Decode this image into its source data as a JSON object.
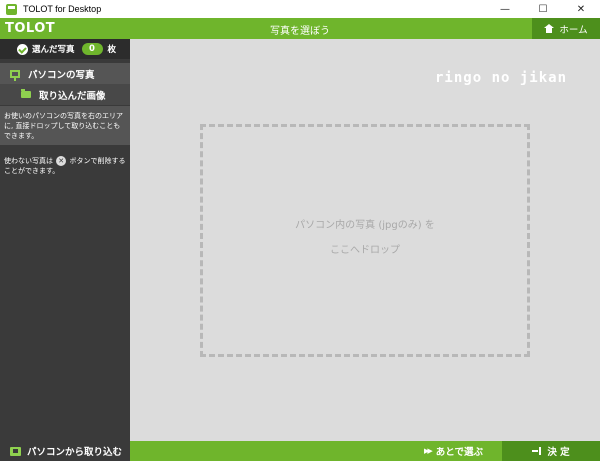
{
  "window": {
    "title": "TOLOT for Desktop",
    "minimize_glyph": "—",
    "maximize_glyph": "☐",
    "close_glyph": "✕"
  },
  "header": {
    "logo": "TOLOT",
    "title": "写真を選ぼう",
    "home_label": "ホーム"
  },
  "sidebar": {
    "selected_label": "選んだ写真",
    "selected_count": "0",
    "selected_unit": "枚",
    "nav_pc_label": "パソコンの写真",
    "nav_import_label": "取り込んだ画像",
    "info_text": "お使いのパソコンの写真を右のエリアに, 直接ドロップして取り込むこともできます。",
    "tip_prefix": "使わない写真は",
    "tip_icon_glyph": "✕",
    "tip_suffix": "ボタンで削除することができます。"
  },
  "main": {
    "brand": "ringo no jikan",
    "drop_line1": "パソコン内の写真 (jpgのみ) を",
    "drop_line2": "ここへドロップ"
  },
  "footer": {
    "import_label": "パソコンから取り込む",
    "later_label": "あとで選ぶ",
    "later_glyph": "▶▶",
    "decide_label": "決 定"
  },
  "colors": {
    "accent_green": "#6fb52c",
    "dark_green": "#4d8f1c",
    "sidebar_dark": "#3a3a3a",
    "drop_area": "#dcdcdc"
  },
  "icons": [
    "app-icon",
    "check-icon",
    "monitor-icon",
    "folder-icon",
    "close-circle-icon",
    "home-icon",
    "import-icon",
    "fast-forward-icon",
    "enter-icon"
  ]
}
